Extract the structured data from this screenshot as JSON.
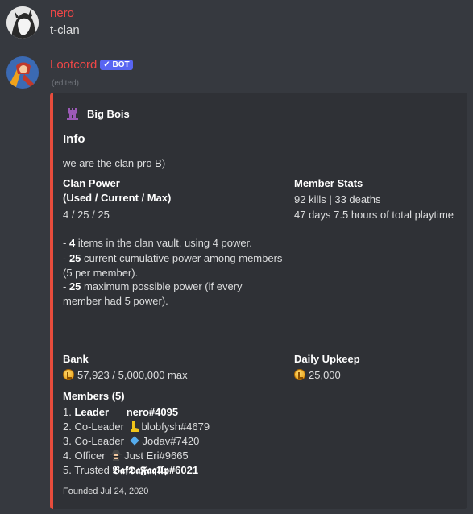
{
  "messages": [
    {
      "author": "nero",
      "author_color": "#f04747",
      "text": "t-clan"
    },
    {
      "author": "Lootcord",
      "author_color": "#f04747",
      "bot_tag": "✓ BOT",
      "edited": "(edited)"
    }
  ],
  "embed": {
    "accent_color": "#e74c3c",
    "author": "Big Bois",
    "author_icon": "castle-tower-icon",
    "title": "Info",
    "description": "we are the clan pro B)",
    "clan_power": {
      "name_line1": "Clan Power",
      "name_line2": "(Used / Current / Max)",
      "value": "4 / 25 / 25"
    },
    "member_stats": {
      "name": "Member Stats",
      "line1": "92 kills | 33 deaths",
      "line2": "47 days 7.5 hours of total playtime"
    },
    "power_notes": [
      {
        "bold": "4",
        "text": " items in the clan vault, using 4 power."
      },
      {
        "bold": "25",
        "text": " current cumulative power among members"
      },
      {
        "text": "(5 per member)."
      },
      {
        "bold": "25",
        "text": " maximum possible power (if every"
      },
      {
        "text": "member had 5 power)."
      }
    ],
    "bank": {
      "name": "Bank",
      "value": "57,923 / 5,000,000 max"
    },
    "daily_upkeep": {
      "name": "Daily Upkeep",
      "value": "25,000"
    },
    "members": {
      "name": "Members (5)",
      "list": [
        {
          "num": "1.",
          "role": "Leader",
          "user": "nero#4095",
          "icon": "crown-icon"
        },
        {
          "num": "2.",
          "role": "Co-Leader",
          "user": "blobfysh#4679",
          "icon": "boot-icon"
        },
        {
          "num": "3.",
          "role": "Co-Leader",
          "user": "Jodav#7420",
          "icon": "diamond-icon"
        },
        {
          "num": "4.",
          "role": "Officer",
          "user": "Just Eri#9665",
          "icon": "spy-icon"
        },
        {
          "num": "5.",
          "role": "Trusted",
          "user": "𝕭𝖆𝖋𝕯𝖆𝕱𝖆𝖖𝖀𝖕#6021",
          "icon": "none"
        }
      ]
    },
    "footer": "Founded Jul 24, 2020"
  }
}
